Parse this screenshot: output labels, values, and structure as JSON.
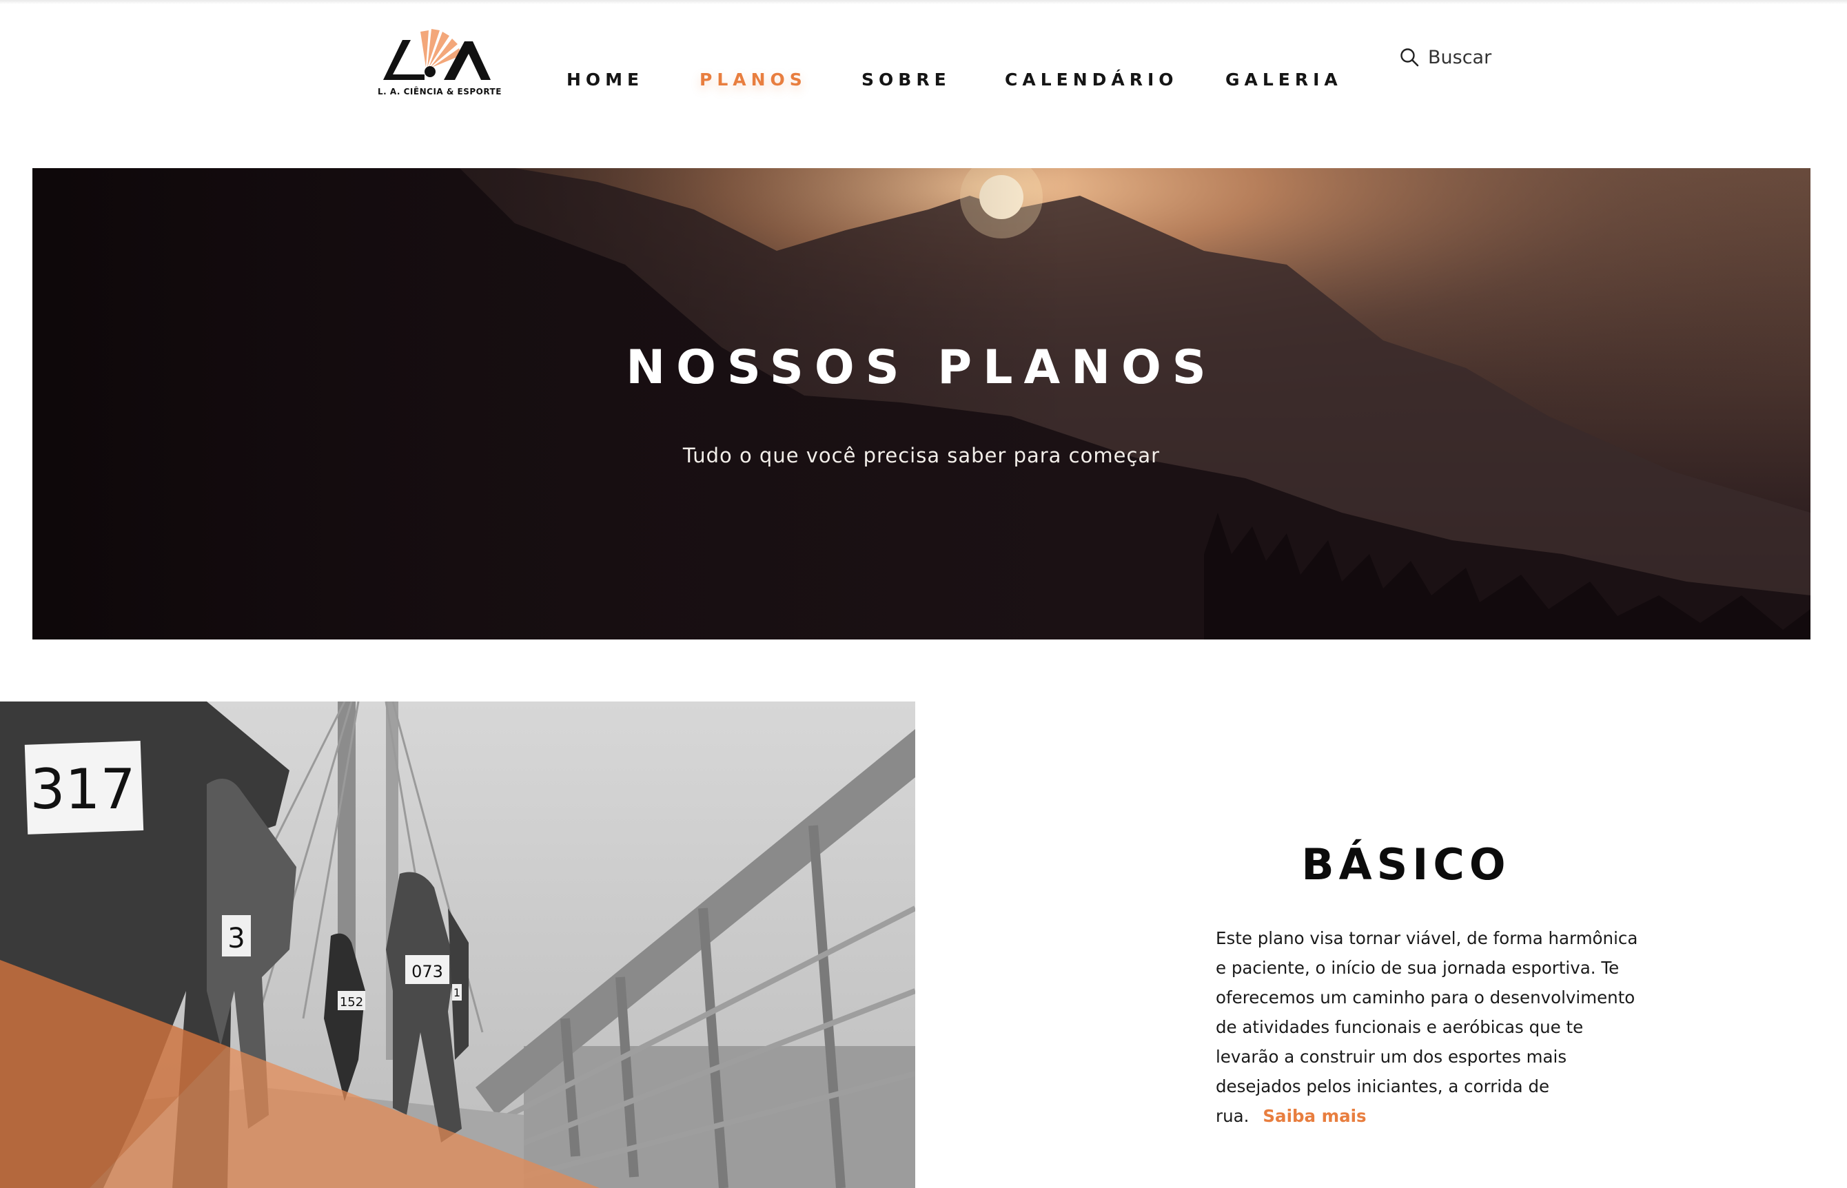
{
  "colors": {
    "accent": "#e87e3f",
    "text": "#151515",
    "background": "#ffffff"
  },
  "header": {
    "logo_text": "L. A. CIÊNCIA & ESPORTE",
    "nav": [
      {
        "label": "HOME"
      },
      {
        "label": "PLANOS",
        "active": true
      },
      {
        "label": "SOBRE"
      },
      {
        "label": "CALENDÁRIO"
      },
      {
        "label": "GALERIA"
      }
    ],
    "search": {
      "icon": "search-icon",
      "label": "Buscar"
    }
  },
  "hero": {
    "title": "NOSSOS PLANOS",
    "subtitle": "Tudo o que você precisa saber para começar"
  },
  "plan": {
    "photo_bibs": [
      "317",
      "3",
      "152",
      "073",
      "1"
    ],
    "title": "BÁSICO",
    "description": "Este plano visa tornar viável, de forma harmônica e paciente, o início de sua jornada esportiva. Te oferecemos um caminho para o desenvolvimento de atividades funcionais e aeróbicas que te levarão a construir um dos esportes mais desejados pelos iniciantes, a corrida de rua.",
    "link": "Saiba mais"
  }
}
